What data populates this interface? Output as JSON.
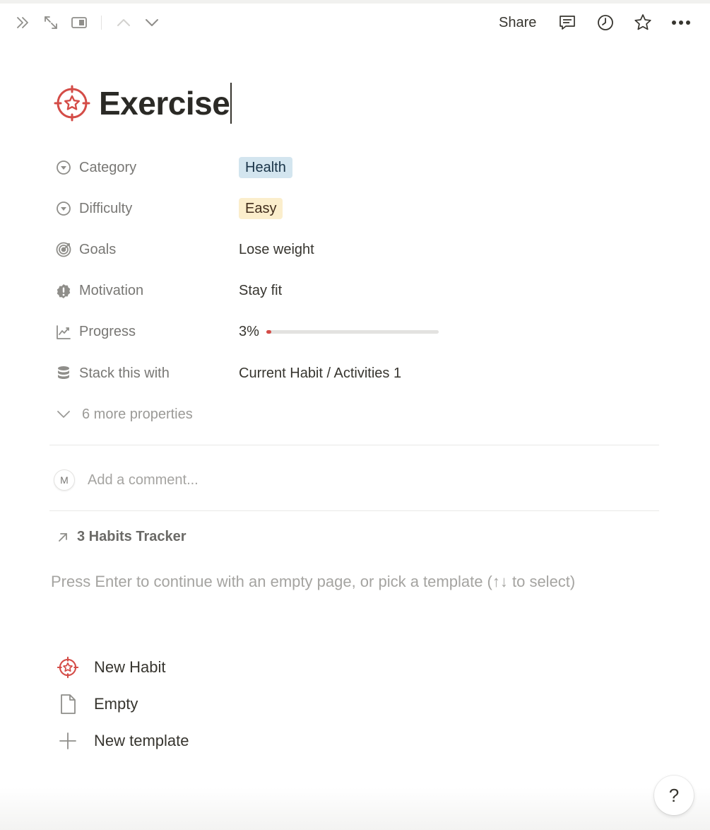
{
  "toolbar": {
    "share_label": "Share",
    "icons": [
      "double-chevron-right-icon",
      "expand-icon",
      "side-peek-icon",
      "chevron-up-icon",
      "chevron-down-icon",
      "comment-icon",
      "history-icon",
      "star-icon",
      "more-icon"
    ]
  },
  "page": {
    "title": "Exercise",
    "title_icon": "target-star-icon",
    "accent_color": "#d44c47"
  },
  "properties": [
    {
      "label": "Category",
      "icon": "select-icon",
      "value": "Health",
      "style": "tag-blue"
    },
    {
      "label": "Difficulty",
      "icon": "select-icon",
      "value": "Easy",
      "style": "tag-yellow"
    },
    {
      "label": "Goals",
      "icon": "target-icon",
      "value": "Lose weight"
    },
    {
      "label": "Motivation",
      "icon": "alert-badge-icon",
      "value": "Stay fit"
    },
    {
      "label": "Progress",
      "icon": "trend-chart-icon",
      "value": "3%",
      "progress": 0.03
    },
    {
      "label": "Stack this with",
      "icon": "database-icon",
      "value": "Current Habit / Activities 1"
    }
  ],
  "more_properties": "6 more properties",
  "comment": {
    "avatar_initial": "M",
    "placeholder": "Add a comment..."
  },
  "backlink": {
    "label": "3 Habits Tracker"
  },
  "hint": "Press Enter to continue with an empty page, or pick a template (↑↓ to select)",
  "templates": [
    {
      "label": "New Habit",
      "icon": "target-star-icon"
    },
    {
      "label": "Empty",
      "icon": "page-icon"
    },
    {
      "label": "New template",
      "icon": "plus-icon"
    }
  ],
  "help_label": "?"
}
